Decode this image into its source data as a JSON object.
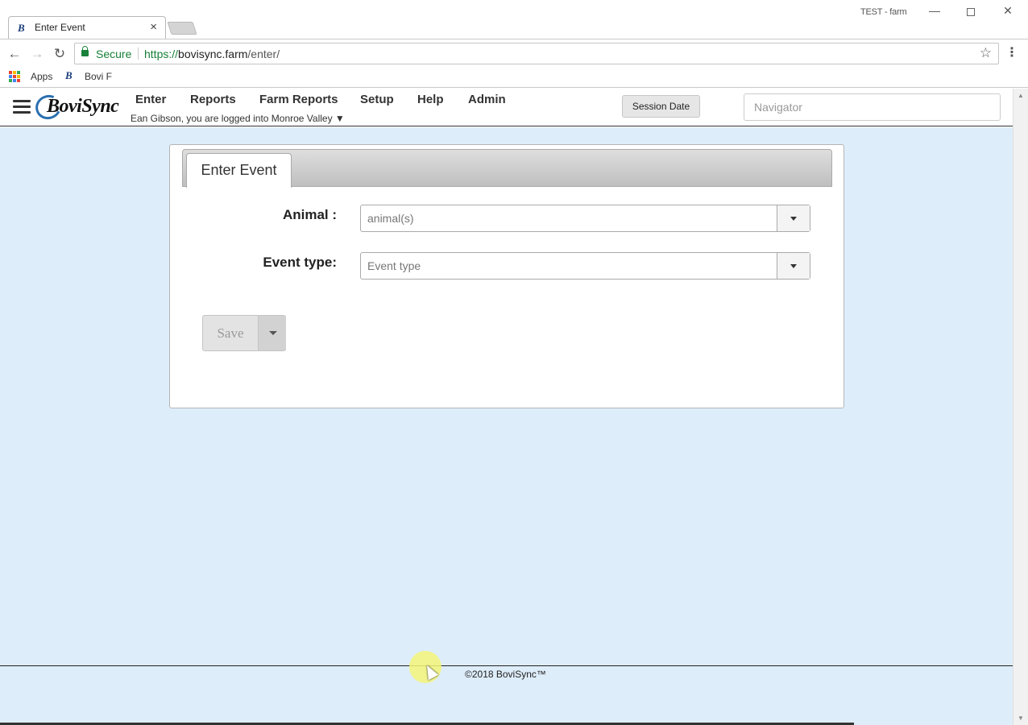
{
  "browser": {
    "tab_title": "Enter Event",
    "tab_close_glyph": "×",
    "window_label": "TEST - farm",
    "min_glyph": "—",
    "close_glyph": "✕",
    "secure_label": "Secure",
    "url_scheme": "https://",
    "url_host": "bovisync.farm",
    "url_path": "/enter/",
    "back_glyph": "←",
    "forward_glyph": "→",
    "reload_glyph": "↻",
    "star_glyph": "☆",
    "menu_glyph": "⋮",
    "bookmarks": {
      "apps_label": "Apps",
      "bovi_label": "Bovi F"
    },
    "favicon_glyph": "B",
    "apps_colors": [
      "#ea4335",
      "#fbbc05",
      "#34a853",
      "#4285f4",
      "#ea4335",
      "#fbbc05",
      "#34a853",
      "#4285f4",
      "#ea4335"
    ]
  },
  "header": {
    "logo_text": "BoviSync",
    "nav": {
      "enter": "Enter",
      "reports": "Reports",
      "farm_reports": "Farm Reports",
      "setup": "Setup",
      "help": "Help",
      "admin": "Admin"
    },
    "login_info": "Ean Gibson, you are logged into Monroe Valley ▼",
    "session_date_label": "Session Date",
    "navigator_placeholder": "Navigator"
  },
  "form": {
    "tab_label": "Enter Event",
    "animal_label": "Animal :",
    "animal_placeholder": "animal(s)",
    "event_type_label": "Event type:",
    "event_type_placeholder": "Event type",
    "save_label": "Save"
  },
  "footer": {
    "copyright": "©2018 BoviSync™"
  },
  "scroll": {
    "up_glyph": "▲",
    "down_glyph": "▼"
  },
  "colors": {
    "content_bg": "#deedfa",
    "secure_green": "#188038",
    "logo_blue": "#2a6fb0"
  }
}
